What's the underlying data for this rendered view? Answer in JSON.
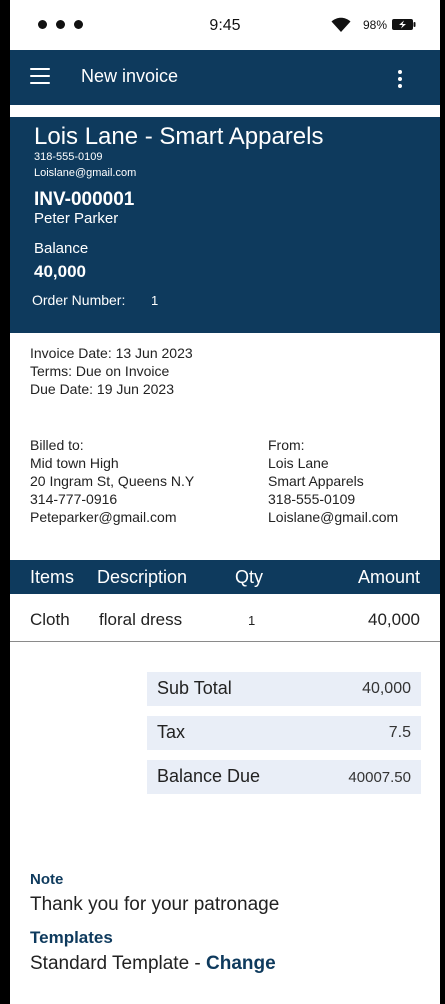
{
  "status_bar": {
    "time": "9:45",
    "battery": "98%"
  },
  "app_bar": {
    "title": "New invoice"
  },
  "header": {
    "company_name": "Lois Lane - Smart Apparels",
    "company_phone": "318-555-0109",
    "company_email": "Loislane@gmail.com",
    "invoice_number": "INV-000001",
    "client_name": "Peter Parker",
    "balance_label": "Balance",
    "balance_value": "40,000",
    "order_label": "Order Number:",
    "order_value": "1"
  },
  "dates": {
    "invoice_date": "Invoice Date: 13 Jun 2023",
    "terms": "Terms: Due on Invoice",
    "due_date": "Due Date: 19 Jun 2023"
  },
  "billed_to": {
    "label": "Billed to:",
    "name": "Mid town High",
    "address": "20 Ingram St, Queens N.Y",
    "phone": "314-777-0916",
    "email": "Peteparker@gmail.com"
  },
  "from": {
    "label": "From:",
    "name": "Lois Lane",
    "company": "Smart Apparels",
    "phone": "318-555-0109",
    "email": "Loislane@gmail.com"
  },
  "table": {
    "headers": {
      "items": "Items",
      "description": "Description",
      "qty": "Qty",
      "amount": "Amount"
    },
    "rows": [
      {
        "item": "Cloth",
        "description": "floral dress",
        "qty": "1",
        "amount": "40,000"
      }
    ]
  },
  "totals": {
    "subtotal_label": "Sub Total",
    "subtotal_value": "40,000",
    "tax_label": "Tax",
    "tax_value": "7.5",
    "balance_due_label": "Balance Due",
    "balance_due_value": "40007.50"
  },
  "note": {
    "label": "Note",
    "text": "Thank you for  your patronage"
  },
  "templates": {
    "label": "Templates",
    "current": "Standard Template - ",
    "change": "Change"
  },
  "colors": {
    "primary": "#0e3a5d",
    "total_bg": "#e9eef7"
  }
}
